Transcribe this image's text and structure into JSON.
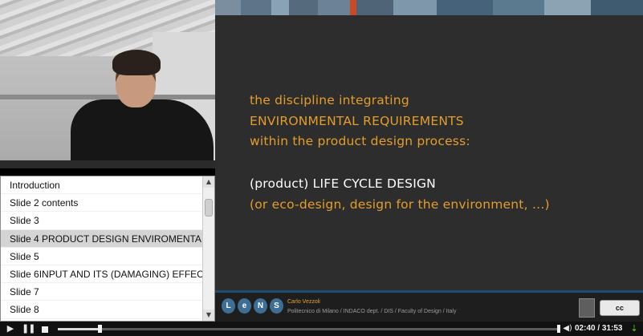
{
  "slide_list": {
    "items": [
      {
        "label": "Introduction",
        "selected": false
      },
      {
        "label": "Slide 2 contents",
        "selected": false
      },
      {
        "label": "Slide 3",
        "selected": false
      },
      {
        "label": "Slide 4 PRODUCT DESIGN ENVIROMENTA",
        "selected": true
      },
      {
        "label": "Slide 5",
        "selected": false
      },
      {
        "label": "Slide 6INPUT AND ITS (DAMAGING) EFFEC",
        "selected": false
      },
      {
        "label": "Slide 7",
        "selected": false
      },
      {
        "label": "Slide 8",
        "selected": false
      }
    ]
  },
  "slide": {
    "lines": [
      {
        "text": "the discipline integrating",
        "color": "#e39d2c"
      },
      {
        "text": "ENVIRONMENTAL REQUIREMENTS",
        "color": "#e39d2c"
      },
      {
        "text": "within the product design process:",
        "color": "#e39d2c"
      },
      {
        "text": "(product) LIFE CYCLE DESIGN",
        "color": "#ffffff"
      },
      {
        "text": "(or eco-design, design for the environment, …)",
        "color": "#e39d2c"
      }
    ],
    "stripe_colors": [
      "#7a8ea0",
      "#5d7489",
      "#8aa2b5",
      "#556a7c",
      "#6c8397",
      "#c94a25",
      "#4f6577",
      "#7f97aa",
      "#46627a",
      "#5c7a8f",
      "#8ba3b3",
      "#3f5b70"
    ],
    "footer": {
      "logo_letters": [
        "L",
        "e",
        "N",
        "S"
      ],
      "author": "Carlo Vezzoli",
      "affiliation": "Politecnico di Milano / INDACO dept. / DIS / Faculty of Design / Italy",
      "license": "cc"
    }
  },
  "player": {
    "time_current": "02:40",
    "time_total": "31:53",
    "progress_fraction": 0.0837,
    "icons": {
      "play": "play-icon",
      "pause": "pause-icon",
      "stop": "stop-icon",
      "volume": "volume-icon",
      "download": "download-icon"
    }
  }
}
